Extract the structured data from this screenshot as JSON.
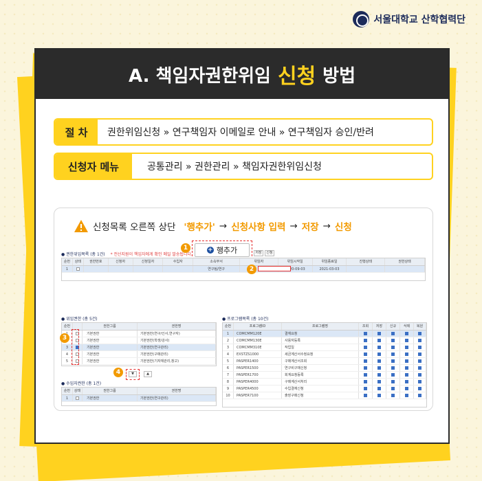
{
  "brand": {
    "name": "서울대학교 산학협력단",
    "color": "#1c2b5a"
  },
  "colors": {
    "accent": "#ffd21f",
    "highlight": "#f29a00",
    "dark": "#2b2b2b",
    "alert": "#e53030"
  },
  "title": {
    "prefix": "A. 책임자권한위임",
    "accent": "신청",
    "suffix": "방법"
  },
  "procedure": {
    "label": "절 차",
    "text": "권한위임신청 » 연구책임자 이메일로 안내 » 연구책임자 승인/반려"
  },
  "menu": {
    "label": "신청자 메뉴",
    "text": "공통관리 » 권한관리 » 책임자권한위임신청"
  },
  "instruction": {
    "lead": "신청목록 오른쪽 상단",
    "step1": "'행추가'",
    "arrow1": "→",
    "step2": "신청사항 입력",
    "arrow2": "→",
    "step3": "저장",
    "arrow3": "→",
    "step4": "신청"
  },
  "screen": {
    "add_row_label": "행추가",
    "save_label": "저장",
    "apply_label": "신청",
    "list_panel": {
      "title": "권한위임목록",
      "count": "(총 1건)",
      "note": "* 전산지원이 책임자에게 확인 메일 발송됩니다."
    },
    "list_headers": [
      "순번",
      "상태",
      "권한번호",
      "신청자",
      "신청일자",
      "수입자",
      "소속부서",
      "위임자",
      "위임시작일",
      "위임종료일",
      "진행상태",
      "권한상태"
    ],
    "list_rows": [
      {
        "no": "1",
        "dept": "연구팀/연구",
        "start": "2020-09-03",
        "end": "2021-03-03"
      }
    ],
    "grant_panel": {
      "title": "위임권한",
      "count": "(총 5건)"
    },
    "grant_headers": [
      "순번",
      "",
      "권한그룹",
      "권한명"
    ],
    "grant_rows": [
      {
        "no": "1",
        "group": "기본권한",
        "name": "기본권한(연구/인사,연구자)",
        "checked": false
      },
      {
        "no": "2",
        "group": "기본권한",
        "name": "기본권한(학생/강사)",
        "checked": false
      },
      {
        "no": "3",
        "group": "기본권한",
        "name": "기본권한(연구관리)",
        "checked": true
      },
      {
        "no": "4",
        "group": "기본권한",
        "name": "기본권한(구매관리)",
        "checked": false
      },
      {
        "no": "5",
        "group": "기본권한",
        "name": "기본권한(기자재관리,창고)",
        "checked": false
      }
    ],
    "move_down": "▼",
    "move_up": "▲",
    "recv_panel": {
      "title": "수임자권한",
      "count": "(총 1건)"
    },
    "recv_headers": [
      "순번",
      "상태",
      "권한그룹",
      "권한명"
    ],
    "recv_rows": [
      {
        "no": "1",
        "group": "기본권한",
        "name": "기본권한(연구관리)"
      }
    ],
    "program_panel": {
      "title": "프로그램목록",
      "count": "(총 10건)"
    },
    "program_headers": [
      "순번",
      "프로그램ID",
      "프로그램명",
      "조회",
      "저장",
      "신규",
      "삭제",
      "복원"
    ],
    "program_rows": [
      {
        "no": "1",
        "id": "COMCMM120E",
        "name": "결재요청"
      },
      {
        "no": "2",
        "id": "COMCMM130E",
        "name": "사용자등록"
      },
      {
        "no": "3",
        "id": "COMCMM310E",
        "name": "작업일"
      },
      {
        "no": "4",
        "id": "EXSTZS1000",
        "name": "세금계산서수정요청"
      },
      {
        "no": "5",
        "id": "PASPER1400",
        "name": "구매계산서조회"
      },
      {
        "no": "6",
        "id": "PASPER1500",
        "name": "연구비구매신청"
      },
      {
        "no": "7",
        "id": "PASPER1700",
        "name": "회계요청등록"
      },
      {
        "no": "8",
        "id": "PASPER4000",
        "name": "구매계산서처리"
      },
      {
        "no": "9",
        "id": "PASPER4500",
        "name": "수입결재신청"
      },
      {
        "no": "10",
        "id": "PASPER7100",
        "name": "출장구매신청"
      }
    ],
    "badges": [
      "1",
      "2",
      "3",
      "4"
    ]
  }
}
